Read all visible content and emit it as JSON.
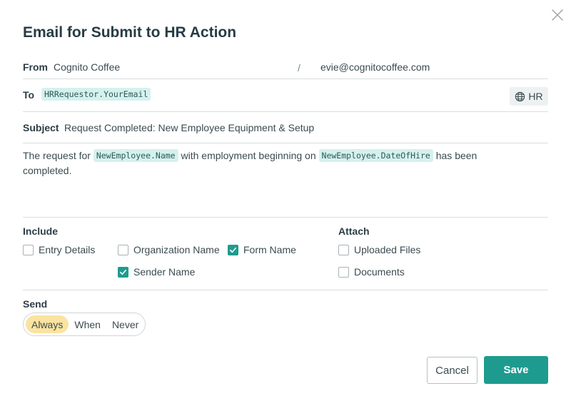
{
  "dialog": {
    "title": "Email for Submit to HR Action"
  },
  "from": {
    "label": "From",
    "name": "Cognito Coffee",
    "separator": "/",
    "email": "evie@cognitocoffee.com"
  },
  "to": {
    "label": "To",
    "token": "HRRequestor.YourEmail",
    "language_button": "HR",
    "language_icon": "globe-icon"
  },
  "subject": {
    "label": "Subject",
    "value": "Request Completed: New Employee Equipment & Setup"
  },
  "body": {
    "part1": "The request for",
    "token1": "NewEmployee.Name",
    "part2": "with employment beginning on",
    "token2": "NewEmployee.DateOfHire",
    "part3": "has been completed."
  },
  "include": {
    "label": "Include",
    "options": [
      {
        "label": "Entry Details",
        "checked": false
      },
      {
        "label": "Organization Name",
        "checked": false
      },
      {
        "label": "Form Name",
        "checked": true
      },
      {
        "label": "Sender Name",
        "checked": true
      }
    ]
  },
  "attach": {
    "label": "Attach",
    "options": [
      {
        "label": "Uploaded Files",
        "checked": false
      },
      {
        "label": "Documents",
        "checked": false
      }
    ]
  },
  "send": {
    "label": "Send",
    "options": [
      "Always",
      "When",
      "Never"
    ],
    "selected": "Always"
  },
  "actions": {
    "cancel": "Cancel",
    "save": "Save"
  },
  "colors": {
    "accent": "#1e9b8f",
    "token_bg": "#d5f1ee",
    "selected_segment": "#fbe3a0"
  }
}
